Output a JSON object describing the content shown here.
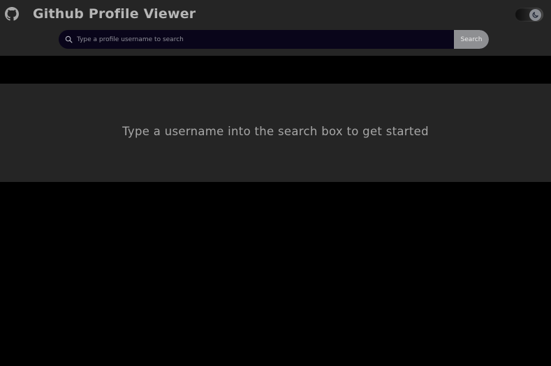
{
  "header": {
    "logo_icon": "github-icon",
    "title": "Github Profile Viewer",
    "theme_toggle_icon": "moon-icon"
  },
  "search": {
    "icon": "search-icon",
    "placeholder": "Type a profile username to search",
    "value": "",
    "button_label": "Search"
  },
  "main": {
    "empty_message": "Type a username into the search box to get started"
  },
  "colors": {
    "page_background": "#000000",
    "header_background": "#252525",
    "panel_background": "#252525",
    "search_field_background": "#09051a",
    "search_button_background": "#8e8f92",
    "text_muted": "#a6a6a6"
  }
}
